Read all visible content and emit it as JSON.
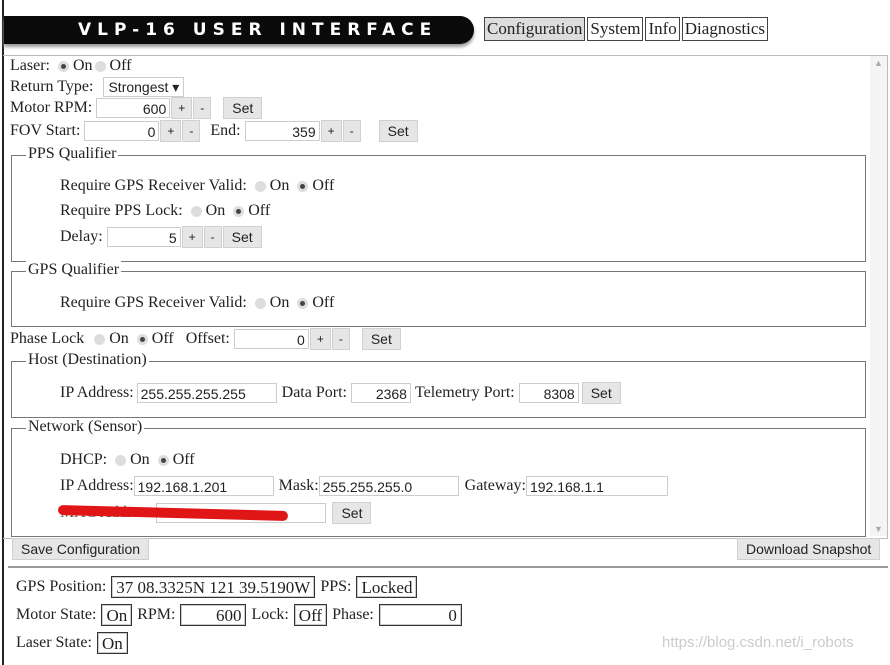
{
  "header": {
    "title": "VLP-16 USER INTERFACE",
    "tabs": [
      "Configuration",
      "System",
      "Info",
      "Diagnostics"
    ],
    "active_tab": "Configuration"
  },
  "config": {
    "laser": {
      "label": "Laser:",
      "on": "On",
      "off": "Off",
      "value": "On"
    },
    "return_type": {
      "label": "Return Type:",
      "value": "Strongest ▾"
    },
    "motor": {
      "label": "Motor  RPM:",
      "value": "600"
    },
    "fov": {
      "start_label": "FOV  Start:",
      "start": "0",
      "end_label": "End:",
      "end": "359"
    },
    "buttons": {
      "plus": "+",
      "minus": "-",
      "set": "Set"
    },
    "pps": {
      "legend": "PPS Qualifier",
      "gps_valid_label": "Require GPS Receiver Valid:",
      "gps_valid": "Off",
      "pps_lock_label": "Require PPS Lock:",
      "pps_lock": "Off",
      "delay_label": "Delay:",
      "delay": "5",
      "on": "On",
      "off": "Off"
    },
    "gps": {
      "legend": "GPS Qualifier",
      "gps_valid_label": "Require GPS Receiver Valid:",
      "gps_valid": "Off",
      "on": "On",
      "off": "Off"
    },
    "phase": {
      "label": "Phase Lock",
      "on": "On",
      "off": "Off",
      "value": "Off",
      "offset_label": "Offset:",
      "offset": "0"
    },
    "host": {
      "legend": "Host (Destination)",
      "ip_label": "IP Address:",
      "ip": "255.255.255.255",
      "data_port_label": "Data Port:",
      "data_port": "2368",
      "telemetry_label": "Telemetry Port:",
      "telemetry": "8308"
    },
    "network": {
      "legend": "Network (Sensor)",
      "dhcp_label": "DHCP:",
      "dhcp": "Off",
      "on": "On",
      "off": "Off",
      "ip_label": "IP Address:",
      "ip": "192.168.1.201",
      "mask_label": "Mask:",
      "mask": "255.255.255.0",
      "gateway_label": "Gateway:",
      "gateway": "192.168.1.1",
      "mac_label": "MAC Address:"
    },
    "save": "Save Configuration",
    "download": "Download Snapshot"
  },
  "status": {
    "gps_label": "GPS  Position:",
    "gps": "37 08.3325N 121 39.5190W",
    "pps_label": "PPS:",
    "pps": "Locked",
    "motor_label": "Motor  State:",
    "motor": "On",
    "rpm_label": "RPM:",
    "rpm": "600",
    "lock_label": "Lock:",
    "lock": "Off",
    "phase_label": "Phase:",
    "phase": "0",
    "laser_label": "Laser  State:",
    "laser": "On"
  },
  "watermark": "https://blog.csdn.net/i_robots"
}
